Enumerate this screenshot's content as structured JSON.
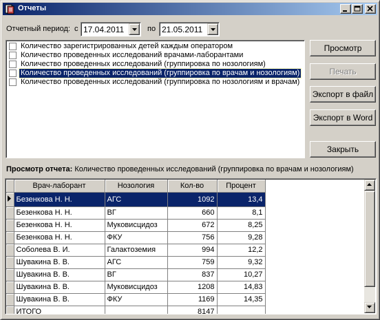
{
  "window": {
    "title": "Отчеты",
    "icon": "report-app-icon",
    "controls": [
      "minimize-icon",
      "maximize-icon",
      "close-icon"
    ]
  },
  "period": {
    "label": "Отчетный период:",
    "from_label": "с",
    "from_value": "17.04.2011",
    "to_label": "по",
    "to_value": "21.05.2011"
  },
  "reports": {
    "items": [
      {
        "label": "Количество зарегистрированных детей каждым оператором",
        "checked": false,
        "selected": false
      },
      {
        "label": "Количество проведенных исследований врачами-лаборантами",
        "checked": false,
        "selected": false
      },
      {
        "label": "Количество проведенных исследований  (группировка по нозологиям)",
        "checked": false,
        "selected": false
      },
      {
        "label": "Количество проведенных исследований  (группировка по врачам и нозологиям)",
        "checked": false,
        "selected": true
      },
      {
        "label": "Количество проведенных исследований  (группировка по нозологиям и врачам)",
        "checked": false,
        "selected": false
      }
    ]
  },
  "buttons": {
    "preview": "Просмотр",
    "print": "Печать",
    "export_file": "Экспорт в файл",
    "export_word": "Экспорт в Word",
    "close": "Закрыть"
  },
  "preview": {
    "caption_bold": "Просмотр отчета:",
    "caption_text": "Количество проведенных исследований  (группировка по врачам и нозологиям)"
  },
  "table": {
    "columns": [
      "Врач-лаборант",
      "Нозология",
      "Кол-во",
      "Процент"
    ],
    "rows": [
      [
        "Безенкова Н. Н.",
        "АГС",
        "1092",
        "13,4"
      ],
      [
        "Безенкова Н. Н.",
        "ВГ",
        "660",
        "8,1"
      ],
      [
        "Безенкова Н. Н.",
        "Муковисцидоз",
        "672",
        "8,25"
      ],
      [
        "Безенкова Н. Н.",
        "ФКУ",
        "756",
        "9,28"
      ],
      [
        "Соболева В. И.",
        "Галактоземия",
        "994",
        "12,2"
      ],
      [
        "Шувакина В. В.",
        "АГС",
        "759",
        "9,32"
      ],
      [
        "Шувакина В. В.",
        "ВГ",
        "837",
        "10,27"
      ],
      [
        "Шувакина В. В.",
        "Муковисцидоз",
        "1208",
        "14,83"
      ],
      [
        "Шувакина В. В.",
        "ФКУ",
        "1169",
        "14,35"
      ],
      [
        "ИТОГО",
        "",
        "8147",
        ""
      ]
    ],
    "selected_row": 0
  },
  "colors": {
    "title_bar": "#0a246a",
    "selection": "#0a246a",
    "face": "#d4d0c8"
  }
}
